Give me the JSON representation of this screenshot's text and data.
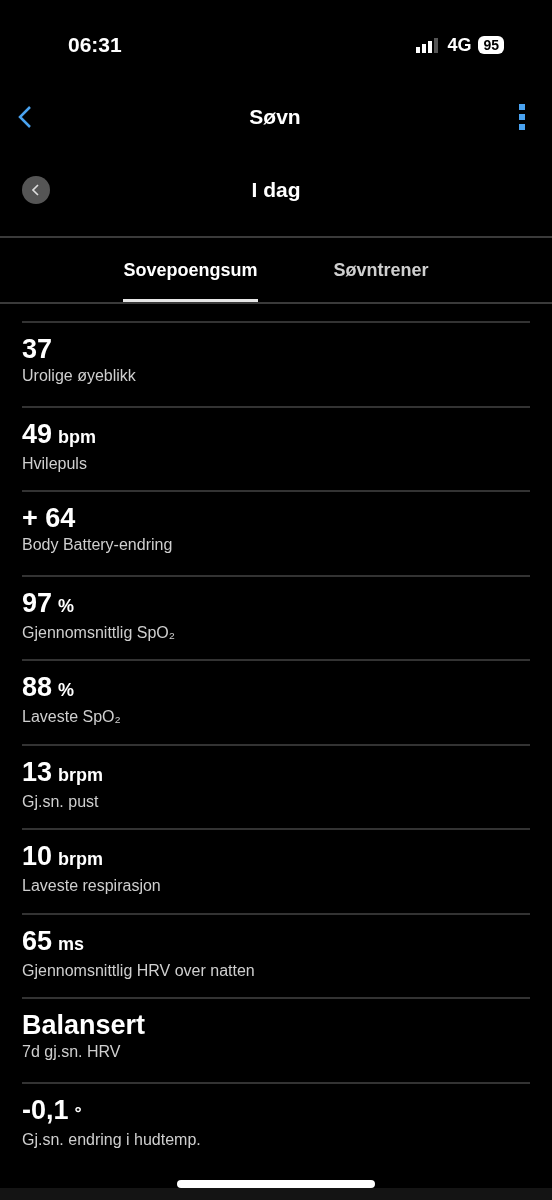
{
  "status_bar": {
    "time": "06:31",
    "network": "4G",
    "battery": "95"
  },
  "nav": {
    "title": "Søvn"
  },
  "date_bar": {
    "label": "I dag"
  },
  "tabs": [
    {
      "label": "Sovepoengsum",
      "selected": true
    },
    {
      "label": "Søvntrener",
      "selected": false
    }
  ],
  "metrics": [
    {
      "value": "37",
      "label": "Urolige øyeblikk"
    },
    {
      "value": "49",
      "unit": "bpm",
      "label": "Hvilepuls"
    },
    {
      "value": "+ 64",
      "label": "Body Battery-endring"
    },
    {
      "value": "97",
      "unit": "%",
      "label": "Gjennomsnittlig SpO₂"
    },
    {
      "value": "88",
      "unit": "%",
      "label": "Laveste SpO₂"
    },
    {
      "value": "13",
      "unit": "brpm",
      "label": "Gj.sn. pust"
    },
    {
      "value": "10",
      "unit": "brpm",
      "label": "Laveste respirasjon"
    },
    {
      "value": "65",
      "unit": "ms",
      "label": "Gjennomsnittlig HRV over natten"
    },
    {
      "value": "Balansert",
      "label": "7d gj.sn. HRV"
    },
    {
      "value": "-0,1",
      "unit": "°",
      "label": "Gj.sn. endring i hudtemp."
    }
  ]
}
